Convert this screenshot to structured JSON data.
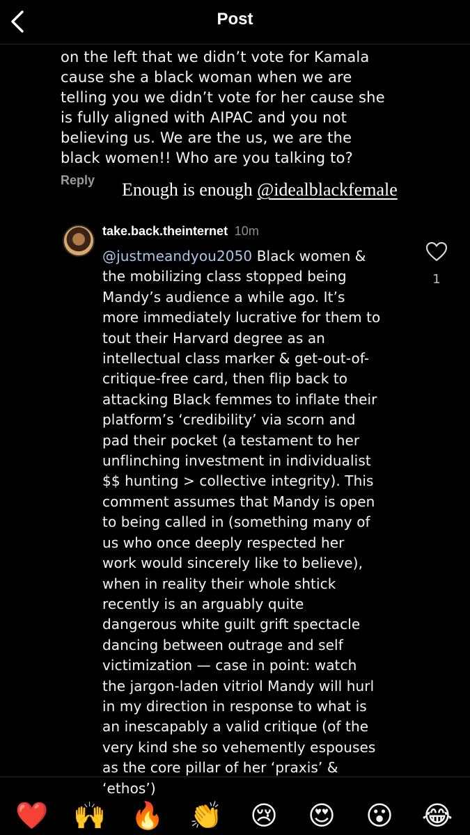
{
  "header": {
    "title": "Post",
    "back_icon": "chevron-left-icon"
  },
  "previous_comment": {
    "lines": [
      "on the left that we didn’t vote for Kamala",
      "cause she a black woman when we are",
      "telling you we didn’t vote for her cause she",
      "is fully aligned with AIPAC and you not",
      "believing us. We are the us, we are the",
      "black women!! Who are you talking to?"
    ],
    "reply_label": "Reply"
  },
  "overlay": {
    "text": "Enough is enough ",
    "handle": "@idealblackfemale"
  },
  "comment": {
    "username": "take.back.theinternet",
    "time": "10m",
    "mention": "@justmeandyou2050",
    "first_line_rest": " Black women &",
    "lines": [
      "the mobilizing class stopped being",
      "Mandy’s audience a while ago. It’s",
      "more immediately lucrative for them to",
      "tout their Harvard degree as an",
      "intellectual class marker & get-out-of-",
      "critique-free card, then flip back to",
      "attacking Black femmes to inflate their",
      "platform’s ‘credibility’ via scorn and",
      "pad their pocket (a testament to her",
      "unflinching investment in individualist",
      "$$ hunting > collective integrity). This",
      "comment assumes that Mandy is open",
      "to being called in (something many of",
      "us who once deeply respected her",
      "work would sincerely like to believe),",
      "when in reality their whole shtick",
      "recently is an arguably quite",
      "dangerous white guilt grift spectacle",
      "dancing between outrage and self",
      "victimization — case in point: watch",
      "the jargon-laden vitriol Mandy will hurl",
      "in my direction in response to what is",
      "an inescapably a valid critique (of the",
      "very kind she so vehemently espouses",
      "as the core pillar of her ‘praxis’ &",
      "‘ethos’)"
    ],
    "like_icon": "heart-outline-icon",
    "like_count": "1"
  },
  "emoji_bar": [
    {
      "emoji": "❤️",
      "name": "red-heart"
    },
    {
      "emoji": "🙌",
      "name": "raising-hands"
    },
    {
      "emoji": "🔥",
      "name": "fire"
    },
    {
      "emoji": "👏",
      "name": "clapping-hands"
    },
    {
      "emoji": "😢",
      "name": "crying-face"
    },
    {
      "emoji": "😍",
      "name": "heart-eyes"
    },
    {
      "emoji": "😮",
      "name": "open-mouth-face"
    },
    {
      "emoji": "😂",
      "name": "tears-of-joy"
    }
  ]
}
